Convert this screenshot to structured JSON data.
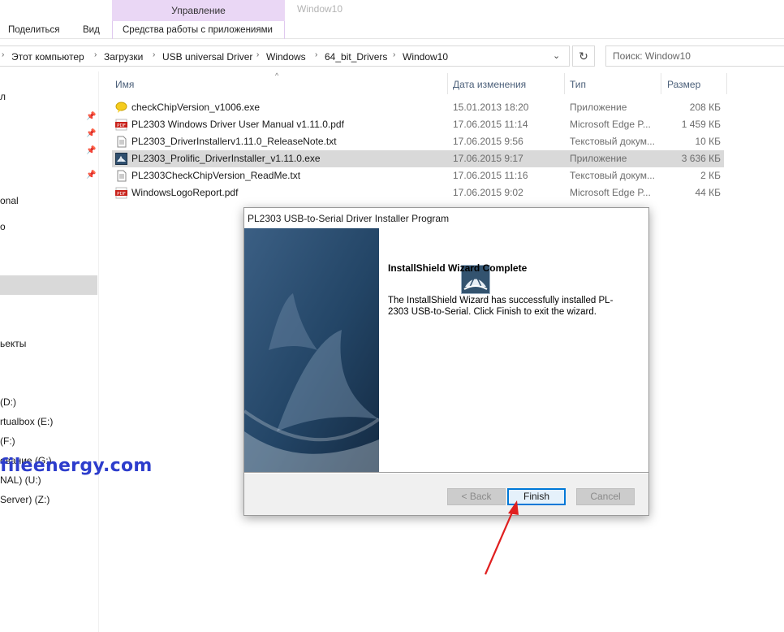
{
  "ribbon": {
    "context_header": "Управление",
    "window_title": "Window10",
    "tabs": [
      "Поделиться",
      "Вид",
      "Средства работы с приложениями"
    ]
  },
  "address": {
    "crumbs": [
      "Этот компьютер",
      "Загрузки",
      "USB universal Driver",
      "Windows",
      "64_bit_Drivers",
      "Window10"
    ],
    "search_placeholder": "Поиск: Window10"
  },
  "nav": {
    "items": [
      "л",
      "onal",
      "о",
      "ьекты",
      "(D:)",
      "rtualbox (E:)",
      "(F:)",
      "ование (G:)",
      "NAL) (U:)",
      "Server) (Z:)"
    ]
  },
  "list": {
    "headers": {
      "name": "Имя",
      "date": "Дата изменения",
      "type": "Тип",
      "size": "Размер"
    },
    "rows": [
      {
        "name": "checkChipVersion_v1006.exe",
        "date": "15.01.2013 18:20",
        "type": "Приложение",
        "size": "208 КБ",
        "icon": "yellow-bubble-icon"
      },
      {
        "name": "PL2303 Windows Driver User Manual v1.11.0.pdf",
        "date": "17.06.2015 11:14",
        "type": "Microsoft Edge P...",
        "size": "1 459 КБ",
        "icon": "pdf-icon"
      },
      {
        "name": "PL2303_DriverInstallerv1.11.0_ReleaseNote.txt",
        "date": "17.06.2015 9:56",
        "type": "Текстовый докум...",
        "size": "10 КБ",
        "icon": "text-file-icon"
      },
      {
        "name": "PL2303_Prolific_DriverInstaller_v1.11.0.exe",
        "date": "17.06.2015 9:17",
        "type": "Приложение",
        "size": "3 636 КБ",
        "icon": "installer-icon"
      },
      {
        "name": "PL2303CheckChipVersion_ReadMe.txt",
        "date": "17.06.2015 11:16",
        "type": "Текстовый докум...",
        "size": "2 КБ",
        "icon": "text-file-icon"
      },
      {
        "name": "WindowsLogoReport.pdf",
        "date": "17.06.2015 9:02",
        "type": "Microsoft Edge P...",
        "size": "44 КБ",
        "icon": "pdf-icon"
      }
    ]
  },
  "watermark": "fileenergy.com",
  "dialog": {
    "title": "PL2303 USB-to-Serial Driver Installer Program",
    "heading": "InstallShield Wizard Complete",
    "body": "The InstallShield Wizard has successfully installed PL-2303 USB-to-Serial.  Click Finish to exit the wizard.",
    "buttons": {
      "back": "< Back",
      "finish": "Finish",
      "cancel": "Cancel"
    }
  },
  "colors": {
    "selection": "#d9d9d9",
    "context_tab": "#ead7f5",
    "annotation_arrow": "#e02020",
    "watermark": "#2d3dcc"
  }
}
